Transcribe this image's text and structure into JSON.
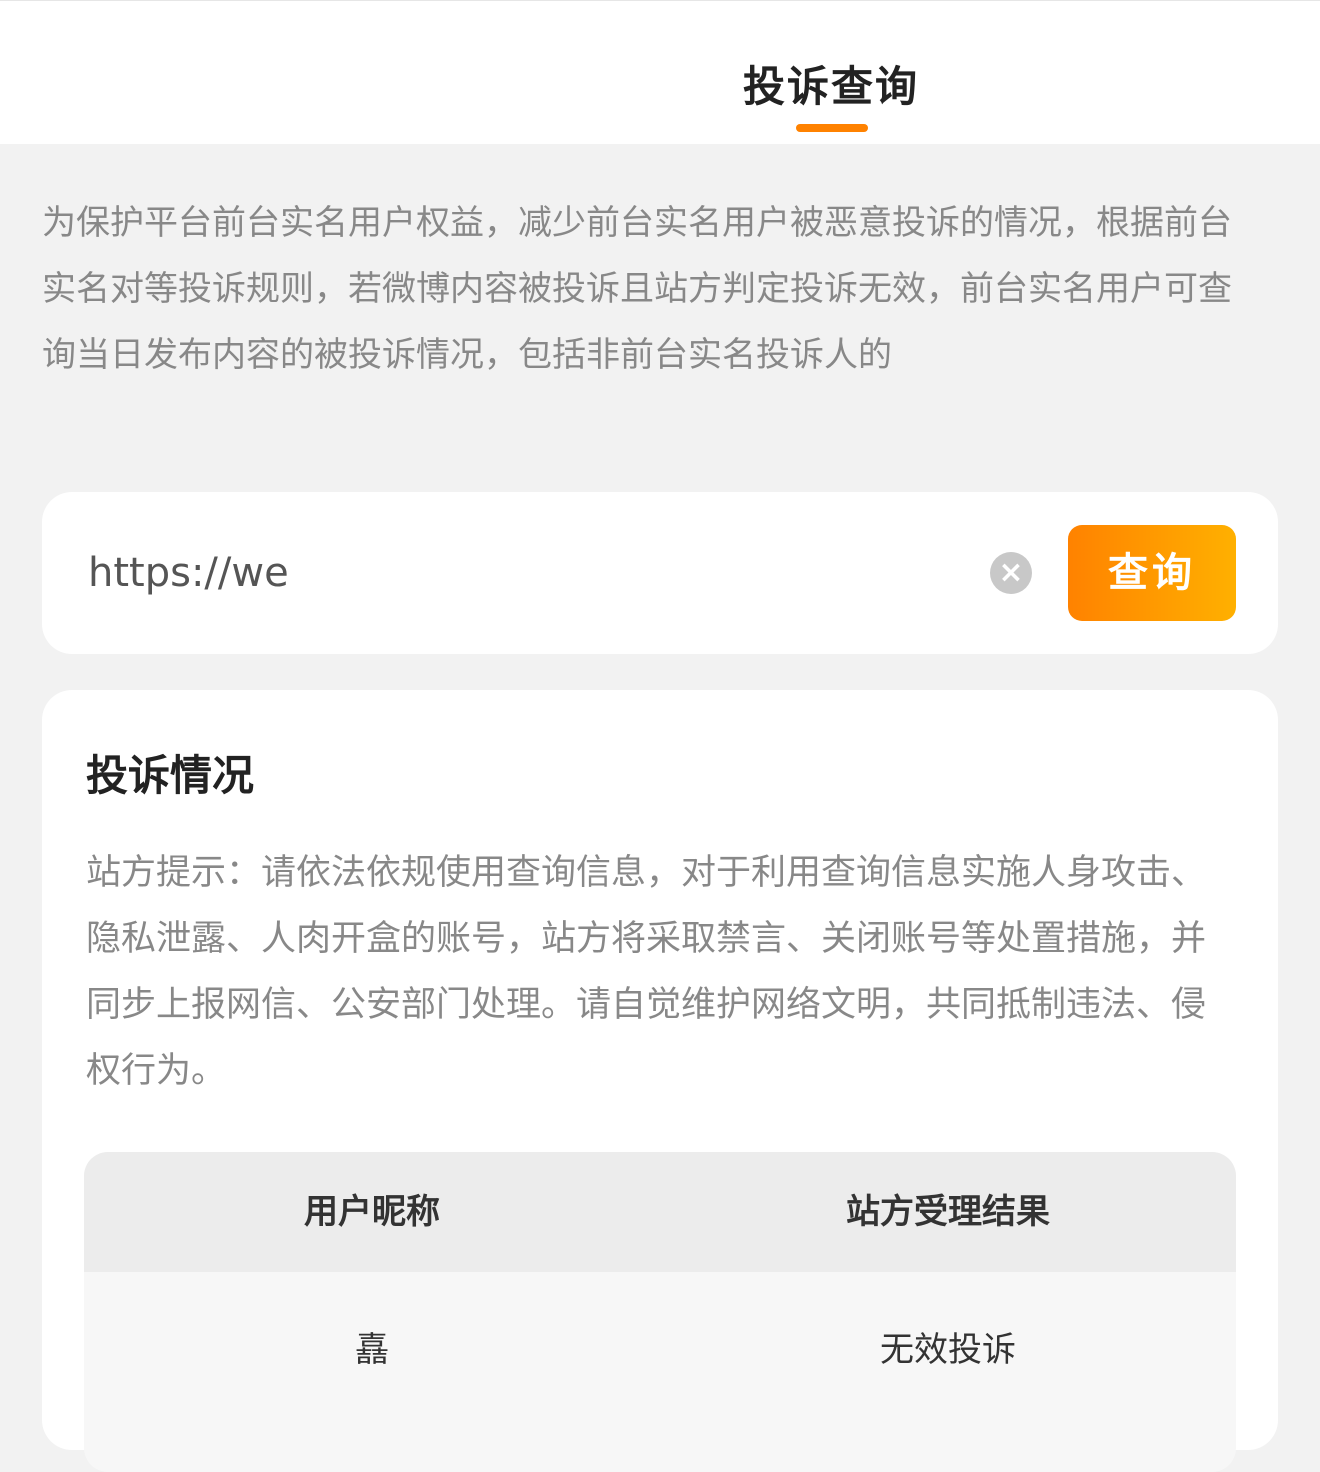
{
  "header": {
    "tab_label": "投诉查询"
  },
  "notice": {
    "text": "为保护平台前台实名用户权益，减少前台实名用户被恶意投诉的情况，根据前台实名对等投诉规则，若微博内容被投诉且站方判定投诉无效，前台实名用户可查询当日发布内容的被投诉情况，包括非前台实名投诉人的"
  },
  "search": {
    "value": "https://we",
    "clear_icon": "×",
    "query_label": "查询"
  },
  "result": {
    "title": "投诉情况",
    "tip": "站方提示：请依法依规使用查询信息，对于利用查询信息实施人身攻击、隐私泄露、人肉开盒的账号，站方将采取禁言、关闭账号等处置措施，并同步上报网信、公安部门处理。请自觉维护网络文明，共同抵制违法、侵权行为。",
    "table": {
      "headers": [
        "用户昵称",
        "站方受理结果"
      ],
      "rows": [
        {
          "nickname": "嚞",
          "result": "无效投诉"
        }
      ]
    }
  },
  "colors": {
    "accent": "#ff8200",
    "accent_end": "#ffb000"
  }
}
